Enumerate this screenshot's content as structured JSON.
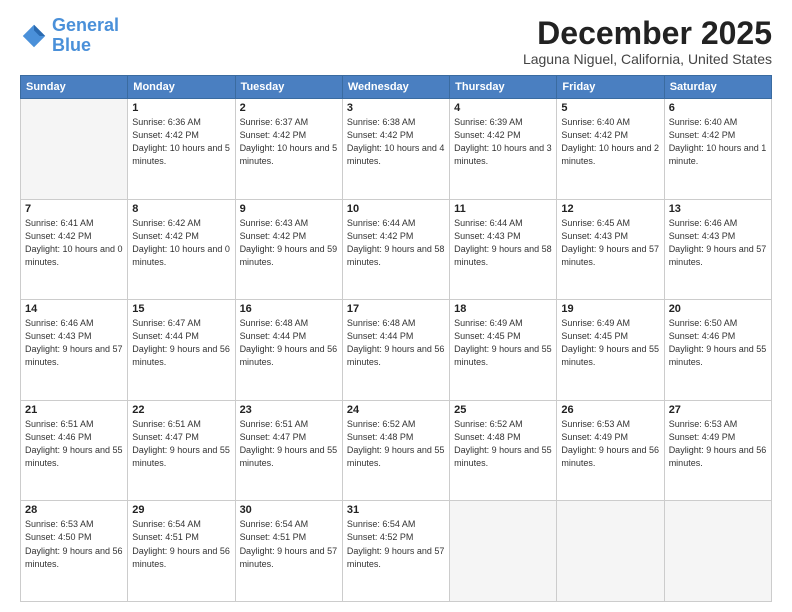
{
  "header": {
    "logo_line1": "General",
    "logo_line2": "Blue",
    "month": "December 2025",
    "location": "Laguna Niguel, California, United States"
  },
  "days_of_week": [
    "Sunday",
    "Monday",
    "Tuesday",
    "Wednesday",
    "Thursday",
    "Friday",
    "Saturday"
  ],
  "weeks": [
    [
      {
        "day": "",
        "empty": true
      },
      {
        "day": "1",
        "sunrise": "6:36 AM",
        "sunset": "4:42 PM",
        "daylight": "10 hours and 5 minutes."
      },
      {
        "day": "2",
        "sunrise": "6:37 AM",
        "sunset": "4:42 PM",
        "daylight": "10 hours and 5 minutes."
      },
      {
        "day": "3",
        "sunrise": "6:38 AM",
        "sunset": "4:42 PM",
        "daylight": "10 hours and 4 minutes."
      },
      {
        "day": "4",
        "sunrise": "6:39 AM",
        "sunset": "4:42 PM",
        "daylight": "10 hours and 3 minutes."
      },
      {
        "day": "5",
        "sunrise": "6:40 AM",
        "sunset": "4:42 PM",
        "daylight": "10 hours and 2 minutes."
      },
      {
        "day": "6",
        "sunrise": "6:40 AM",
        "sunset": "4:42 PM",
        "daylight": "10 hours and 1 minute."
      }
    ],
    [
      {
        "day": "7",
        "sunrise": "6:41 AM",
        "sunset": "4:42 PM",
        "daylight": "10 hours and 0 minutes."
      },
      {
        "day": "8",
        "sunrise": "6:42 AM",
        "sunset": "4:42 PM",
        "daylight": "10 hours and 0 minutes."
      },
      {
        "day": "9",
        "sunrise": "6:43 AM",
        "sunset": "4:42 PM",
        "daylight": "9 hours and 59 minutes."
      },
      {
        "day": "10",
        "sunrise": "6:44 AM",
        "sunset": "4:42 PM",
        "daylight": "9 hours and 58 minutes."
      },
      {
        "day": "11",
        "sunrise": "6:44 AM",
        "sunset": "4:43 PM",
        "daylight": "9 hours and 58 minutes."
      },
      {
        "day": "12",
        "sunrise": "6:45 AM",
        "sunset": "4:43 PM",
        "daylight": "9 hours and 57 minutes."
      },
      {
        "day": "13",
        "sunrise": "6:46 AM",
        "sunset": "4:43 PM",
        "daylight": "9 hours and 57 minutes."
      }
    ],
    [
      {
        "day": "14",
        "sunrise": "6:46 AM",
        "sunset": "4:43 PM",
        "daylight": "9 hours and 57 minutes."
      },
      {
        "day": "15",
        "sunrise": "6:47 AM",
        "sunset": "4:44 PM",
        "daylight": "9 hours and 56 minutes."
      },
      {
        "day": "16",
        "sunrise": "6:48 AM",
        "sunset": "4:44 PM",
        "daylight": "9 hours and 56 minutes."
      },
      {
        "day": "17",
        "sunrise": "6:48 AM",
        "sunset": "4:44 PM",
        "daylight": "9 hours and 56 minutes."
      },
      {
        "day": "18",
        "sunrise": "6:49 AM",
        "sunset": "4:45 PM",
        "daylight": "9 hours and 55 minutes."
      },
      {
        "day": "19",
        "sunrise": "6:49 AM",
        "sunset": "4:45 PM",
        "daylight": "9 hours and 55 minutes."
      },
      {
        "day": "20",
        "sunrise": "6:50 AM",
        "sunset": "4:46 PM",
        "daylight": "9 hours and 55 minutes."
      }
    ],
    [
      {
        "day": "21",
        "sunrise": "6:51 AM",
        "sunset": "4:46 PM",
        "daylight": "9 hours and 55 minutes."
      },
      {
        "day": "22",
        "sunrise": "6:51 AM",
        "sunset": "4:47 PM",
        "daylight": "9 hours and 55 minutes."
      },
      {
        "day": "23",
        "sunrise": "6:51 AM",
        "sunset": "4:47 PM",
        "daylight": "9 hours and 55 minutes."
      },
      {
        "day": "24",
        "sunrise": "6:52 AM",
        "sunset": "4:48 PM",
        "daylight": "9 hours and 55 minutes."
      },
      {
        "day": "25",
        "sunrise": "6:52 AM",
        "sunset": "4:48 PM",
        "daylight": "9 hours and 55 minutes."
      },
      {
        "day": "26",
        "sunrise": "6:53 AM",
        "sunset": "4:49 PM",
        "daylight": "9 hours and 56 minutes."
      },
      {
        "day": "27",
        "sunrise": "6:53 AM",
        "sunset": "4:49 PM",
        "daylight": "9 hours and 56 minutes."
      }
    ],
    [
      {
        "day": "28",
        "sunrise": "6:53 AM",
        "sunset": "4:50 PM",
        "daylight": "9 hours and 56 minutes."
      },
      {
        "day": "29",
        "sunrise": "6:54 AM",
        "sunset": "4:51 PM",
        "daylight": "9 hours and 56 minutes."
      },
      {
        "day": "30",
        "sunrise": "6:54 AM",
        "sunset": "4:51 PM",
        "daylight": "9 hours and 57 minutes."
      },
      {
        "day": "31",
        "sunrise": "6:54 AM",
        "sunset": "4:52 PM",
        "daylight": "9 hours and 57 minutes."
      },
      {
        "day": "",
        "empty": true
      },
      {
        "day": "",
        "empty": true
      },
      {
        "day": "",
        "empty": true
      }
    ]
  ]
}
